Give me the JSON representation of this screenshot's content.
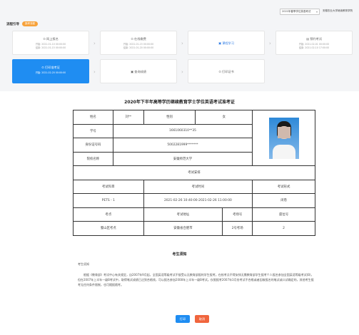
{
  "header": {
    "term_select": "2021年春季学位英语考试",
    "school": "安徽农业大学继续教育学院"
  },
  "flow": {
    "label": "流程引导",
    "badge": "报考流程"
  },
  "steps": [
    {
      "title": "网上报名",
      "dates": [
        "开始: 2021-01-10 00:00:00",
        "结束: 2021-01-15 00:00:00"
      ]
    },
    {
      "title": "在线缴费",
      "dates": [
        "开始: 2021-01-15 00:00:00",
        "结束: 2021-01-20 00:00:00"
      ]
    },
    {
      "title": "课程学习",
      "dates": []
    },
    {
      "title": "预约考试",
      "dates": [
        "开始: 2021-02-01 00:00:00",
        "结束: 2021-02-10 17:00:00"
      ]
    },
    {
      "title": "打印准考证",
      "dates": [
        "开始: 2021-02-20 00:00:00"
      ]
    },
    {
      "title": "查询成绩",
      "dates": []
    },
    {
      "title": "打印证书",
      "dates": []
    }
  ],
  "ticket": {
    "title": "2020年下半年高等学历继续教育学士学位英语考试准考证",
    "labels": {
      "name": "姓名",
      "gender": "性别",
      "student_no": "学号",
      "id_no": "身份证号码",
      "school": "院校名称",
      "exam_arrangement": "考试安排",
      "subject": "考试科目",
      "time": "考试时间",
      "form": "考试形式",
      "site": "考点",
      "address": "考试地址",
      "room": "考场号",
      "seat": "座位号"
    },
    "values": {
      "name": "刘**",
      "gender": "女",
      "student_no": "1661060310**35",
      "id_no": "5002281999*******",
      "school": "安徽师范大学",
      "subject": "PETS - 1",
      "time": "2021-02-26 10:40:00-2021-02-26 11:00:00",
      "form": "闭卷",
      "site": "蜀山区考点",
      "address": "安徽省合肥市",
      "room": "2号考场",
      "seat": "2"
    }
  },
  "notice": {
    "heading": "考生须知",
    "sub": "考生须知",
    "paragraph": "根据《教育部》考试中心有关规定，自2007年9月起，全国英语等级考试不接受以无教育部报的学生报考。在校考点不得安排无需教育部学生报考个人报名参加全国英语等级考试(B)，但在2007年上半年一级B考试中，取得笔试成绩已达到合格线，可以报名参加2008年上半年一级B考试。仅限报考2007年3月份考试不合格或者因故报名的笔试或口试确定的，其他考生报考无任何条件限制，也可随报随考。"
  },
  "buttons": {
    "print": "打印",
    "cancel": "取消"
  },
  "colors": {
    "accent": "#1f8df2",
    "badge": "#f7a23b",
    "cancel": "#f0653d"
  }
}
